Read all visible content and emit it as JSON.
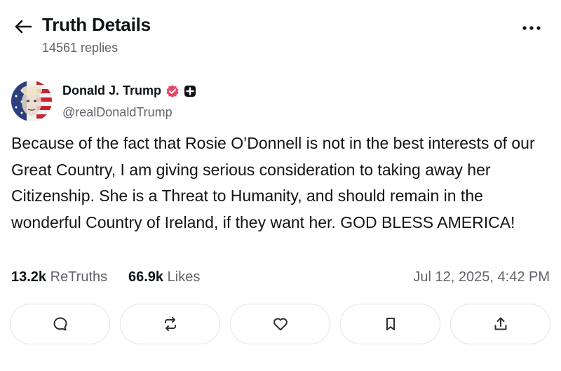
{
  "header": {
    "title": "Truth Details",
    "replies": "14561 replies"
  },
  "author": {
    "name": "Donald J. Trump",
    "handle": "@realDonaldTrump",
    "verified_color": "#e5466b"
  },
  "post": {
    "text": "Because of the fact that Rosie O’Donnell is not in the best interests of our Great Country, I am giving serious consideration to taking away her Citizenship. She is a Threat to Humanity, and should remain in the wonderful Country of Ireland, if they want her. GOD BLESS AMERICA!"
  },
  "stats": {
    "retruths_count": "13.2k",
    "retruths_label": "ReTruths",
    "likes_count": "66.9k",
    "likes_label": "Likes",
    "timestamp": "Jul 12, 2025, 4:42 PM"
  },
  "actions": [
    {
      "icon": "reply-icon"
    },
    {
      "icon": "retruth-icon"
    },
    {
      "icon": "like-icon"
    },
    {
      "icon": "bookmark-icon"
    },
    {
      "icon": "share-icon"
    }
  ],
  "colors": {
    "text": "#0f1419",
    "muted": "#60636b",
    "border": "#e3e4e8"
  }
}
